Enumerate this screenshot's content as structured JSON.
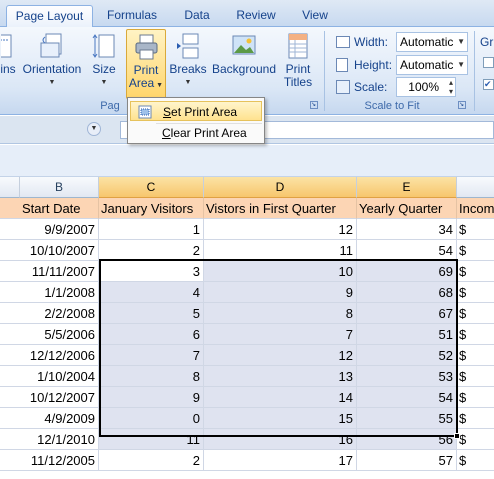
{
  "tabs": [
    {
      "label": "Page Layout",
      "active": true
    },
    {
      "label": "Formulas",
      "active": false
    },
    {
      "label": "Data",
      "active": false
    },
    {
      "label": "Review",
      "active": false
    },
    {
      "label": "View",
      "active": false
    }
  ],
  "ribbon": {
    "page_setup": {
      "margins_partial": "ins",
      "orientation": "Orientation",
      "size": "Size",
      "print_area_line1": "Print",
      "print_area_line2": "Area",
      "breaks": "Breaks",
      "background": "Background",
      "print_titles_line1": "Print",
      "print_titles_line2": "Titles",
      "group_label_partial": "Pag"
    },
    "scale_to_fit": {
      "width_label": "Width:",
      "width_value": "Automatic",
      "height_label": "Height:",
      "height_value": "Automatic",
      "scale_label": "Scale:",
      "scale_value": "100%",
      "group_label": "Scale to Fit"
    },
    "sheet_options_partial": "Gr"
  },
  "print_area_menu": {
    "set": "Set Print Area",
    "set_accel": "S",
    "clear": "Clear Print Area",
    "clear_accel": "C"
  },
  "columns": [
    {
      "letter": "B",
      "header": "Start Date"
    },
    {
      "letter": "C",
      "header": "January Visitors"
    },
    {
      "letter": "D",
      "header": "Vistors in First Quarter"
    },
    {
      "letter": "E",
      "header": "Yearly Quarter"
    },
    {
      "letter": "",
      "header": "Incom"
    }
  ],
  "rows": [
    {
      "date": "9/9/2007",
      "jan": "1",
      "q1": "12",
      "yearly": "34",
      "income": "$"
    },
    {
      "date": "10/10/2007",
      "jan": "2",
      "q1": "11",
      "yearly": "54",
      "income": "$"
    },
    {
      "date": "11/11/2007",
      "jan": "3",
      "q1": "10",
      "yearly": "69",
      "income": "$"
    },
    {
      "date": "1/1/2008",
      "jan": "4",
      "q1": "9",
      "yearly": "68",
      "income": "$"
    },
    {
      "date": "2/2/2008",
      "jan": "5",
      "q1": "8",
      "yearly": "67",
      "income": "$"
    },
    {
      "date": "5/5/2006",
      "jan": "6",
      "q1": "7",
      "yearly": "51",
      "income": "$"
    },
    {
      "date": "12/12/2006",
      "jan": "7",
      "q1": "12",
      "yearly": "52",
      "income": "$"
    },
    {
      "date": "1/10/2004",
      "jan": "8",
      "q1": "13",
      "yearly": "53",
      "income": "$"
    },
    {
      "date": "10/12/2007",
      "jan": "9",
      "q1": "14",
      "yearly": "54",
      "income": "$"
    },
    {
      "date": "4/9/2009",
      "jan": "0",
      "q1": "15",
      "yearly": "55",
      "income": "$"
    },
    {
      "date": "12/1/2010",
      "jan": "11",
      "q1": "16",
      "yearly": "56",
      "income": "$"
    },
    {
      "date": "11/12/2005",
      "jan": "2",
      "q1": "17",
      "yearly": "57",
      "income": "$"
    }
  ],
  "selection": {
    "first_row": 2,
    "last_row": 10
  },
  "colors": {
    "accent": "#15428b",
    "selected_header": "#f7c66d",
    "header_row": "#fcd5b4",
    "selection_fill": "#dfe3f0"
  }
}
